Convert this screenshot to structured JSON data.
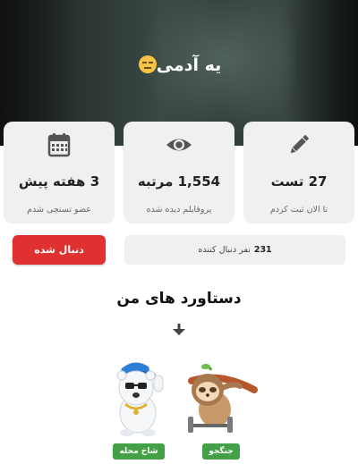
{
  "header": {
    "title": "یه آدمی",
    "title_emoji": "unamused-face-emoji"
  },
  "stats": [
    {
      "icon": "pencil-icon",
      "value": "27 تست",
      "label": "تا الان ثبت کردم"
    },
    {
      "icon": "eye-icon",
      "value": "1,554 مرتبه",
      "label": "پروفایلم دیده شده"
    },
    {
      "icon": "calendar-icon",
      "value": "3 هفته پیش",
      "label": "عضو تستچی شدم"
    }
  ],
  "followers": {
    "count": "231",
    "label": "نفر دنبال کننده"
  },
  "follow_button": {
    "label": "دنبال شده"
  },
  "achievements": {
    "title": "دستاورد های من",
    "items": [
      {
        "name": "جنگجو",
        "icon": "sloth-weightlifting-icon"
      },
      {
        "name": "شاخ محله",
        "icon": "polar-bear-rapper-icon"
      }
    ]
  },
  "colors": {
    "accent_red": "#e03131",
    "badge_green": "#43a047",
    "card_bg": "#f0f0f0"
  }
}
